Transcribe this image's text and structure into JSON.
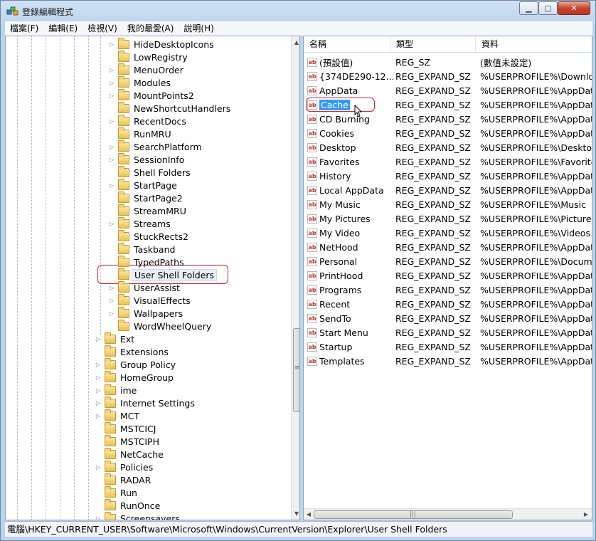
{
  "window": {
    "title": "登錄編輯程式",
    "min_label": "▁",
    "max_label": "▢",
    "close_label": "✕"
  },
  "menu": [
    "檔案(F)",
    "編輯(E)",
    "檢視(V)",
    "我的最愛(A)",
    "說明(H)"
  ],
  "tree": {
    "deep_items": [
      "HideDesktopIcons",
      "LowRegistry",
      "MenuOrder",
      "Modules",
      "MountPoints2",
      "NewShortcutHandlers",
      "RecentDocs",
      "RunMRU",
      "SearchPlatform",
      "SessionInfo",
      "Shell Folders",
      "StartPage",
      "StartPage2",
      "StreamMRU",
      "Streams",
      "StuckRects2",
      "Taskband",
      "TypedPaths",
      "User Shell Folders",
      "UserAssist",
      "VisualEffects",
      "Wallpapers",
      "WordWheelQuery"
    ],
    "deep_expandable": [
      true,
      false,
      true,
      true,
      true,
      false,
      true,
      false,
      true,
      true,
      false,
      true,
      false,
      false,
      true,
      false,
      false,
      false,
      false,
      true,
      true,
      true,
      false
    ],
    "selected": "User Shell Folders",
    "upper_items": [
      "Ext",
      "Extensions",
      "Group Policy",
      "HomeGroup",
      "ime",
      "Internet Settings",
      "MCT",
      "MSTCICJ",
      "MSTCIPH",
      "NetCache",
      "Policies",
      "RADAR",
      "Run",
      "RunOnce",
      "Screensavers"
    ],
    "upper_expandable": [
      true,
      false,
      true,
      true,
      true,
      true,
      true,
      false,
      false,
      false,
      true,
      false,
      false,
      false,
      true
    ]
  },
  "list": {
    "headers": {
      "name": "名稱",
      "type": "類型",
      "data": "資料"
    },
    "rows": [
      {
        "name": "(預設值)",
        "type": "REG_SZ",
        "data": "(數值未設定)"
      },
      {
        "name": "{374DE290-12...",
        "type": "REG_EXPAND_SZ",
        "data": "%USERPROFILE%\\Download"
      },
      {
        "name": "AppData",
        "type": "REG_EXPAND_SZ",
        "data": "%USERPROFILE%\\AppData"
      },
      {
        "name": "Cache",
        "type": "REG_EXPAND_SZ",
        "data": "%USERPROFILE%\\AppData"
      },
      {
        "name": "CD Burning",
        "type": "REG_EXPAND_SZ",
        "data": "%USERPROFILE%\\AppData"
      },
      {
        "name": "Cookies",
        "type": "REG_EXPAND_SZ",
        "data": "%USERPROFILE%\\AppData"
      },
      {
        "name": "Desktop",
        "type": "REG_EXPAND_SZ",
        "data": "%USERPROFILE%\\Desktop"
      },
      {
        "name": "Favorites",
        "type": "REG_EXPAND_SZ",
        "data": "%USERPROFILE%\\Favorites"
      },
      {
        "name": "History",
        "type": "REG_EXPAND_SZ",
        "data": "%USERPROFILE%\\AppData"
      },
      {
        "name": "Local AppData",
        "type": "REG_EXPAND_SZ",
        "data": "%USERPROFILE%\\AppData"
      },
      {
        "name": "My Music",
        "type": "REG_EXPAND_SZ",
        "data": "%USERPROFILE%\\Music"
      },
      {
        "name": "My Pictures",
        "type": "REG_EXPAND_SZ",
        "data": "%USERPROFILE%\\Pictures"
      },
      {
        "name": "My Video",
        "type": "REG_EXPAND_SZ",
        "data": "%USERPROFILE%\\Videos"
      },
      {
        "name": "NetHood",
        "type": "REG_EXPAND_SZ",
        "data": "%USERPROFILE%\\AppData"
      },
      {
        "name": "Personal",
        "type": "REG_EXPAND_SZ",
        "data": "%USERPROFILE%\\Docume"
      },
      {
        "name": "PrintHood",
        "type": "REG_EXPAND_SZ",
        "data": "%USERPROFILE%\\AppData"
      },
      {
        "name": "Programs",
        "type": "REG_EXPAND_SZ",
        "data": "%USERPROFILE%\\AppData"
      },
      {
        "name": "Recent",
        "type": "REG_EXPAND_SZ",
        "data": "%USERPROFILE%\\AppData"
      },
      {
        "name": "SendTo",
        "type": "REG_EXPAND_SZ",
        "data": "%USERPROFILE%\\AppData"
      },
      {
        "name": "Start Menu",
        "type": "REG_EXPAND_SZ",
        "data": "%USERPROFILE%\\AppData"
      },
      {
        "name": "Startup",
        "type": "REG_EXPAND_SZ",
        "data": "%USERPROFILE%\\AppData"
      },
      {
        "name": "Templates",
        "type": "REG_EXPAND_SZ",
        "data": "%USERPROFILE%\\AppData"
      }
    ],
    "selected": "Cache",
    "value_icon": "ab"
  },
  "status": {
    "path": "電腦\\HKEY_CURRENT_USER\\Software\\Microsoft\\Windows\\CurrentVersion\\Explorer\\User Shell Folders"
  },
  "icons": {
    "app": "registry-editor-icon",
    "folder": "folder-icon",
    "string_value": "string-value-icon",
    "expander": "triangle-right-icon"
  },
  "colors": {
    "selection": "#3399ff",
    "highlight_box": "#d9202f",
    "folder": "#e9c158"
  }
}
